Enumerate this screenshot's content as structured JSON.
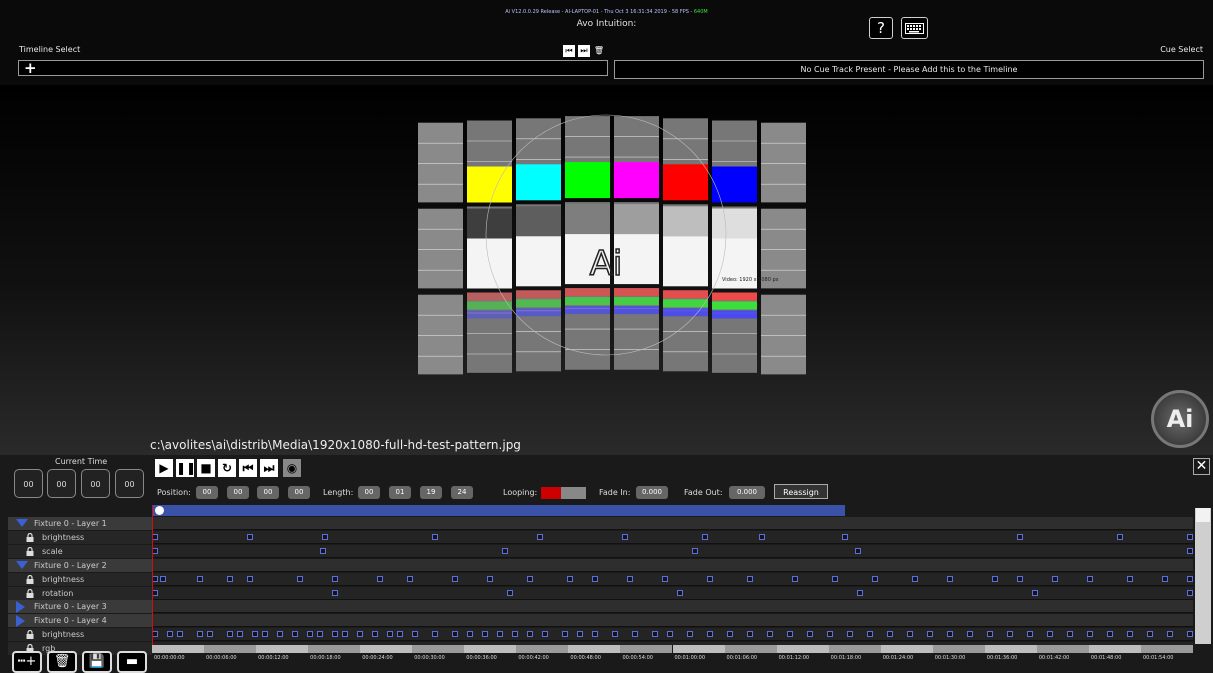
{
  "header": {
    "status_line": "Ai V12.0.0.29 Release - AI-LAPTOP-01 - Thu Oct 3 16:31:34 2019 - 58 FPS -",
    "status_fps": "640M",
    "window_title": "Avo Intuition:",
    "help_label": "?",
    "keyboard_icon": "keyboard-icon"
  },
  "timeline_select": {
    "label": "Timeline Select",
    "add_label": "+"
  },
  "cue_select": {
    "label": "Cue Select",
    "message": "No Cue Track Present - Please Add this to the Timeline"
  },
  "media_path": "c:\\avolites\\ai\\distrib\\Media\\1920x1080-full-hd-test-pattern.jpg",
  "test_pattern": {
    "logo": "Ai",
    "caption": "Video: 1920 x 1080 px"
  },
  "current_time": {
    "label": "Current Time",
    "values": [
      "00",
      "00",
      "00",
      "00"
    ]
  },
  "transport": {
    "position_label": "Position:",
    "position": [
      "00",
      "00",
      "00",
      "00"
    ],
    "length_label": "Length:",
    "length": [
      "00",
      "01",
      "19",
      "24"
    ],
    "looping_label": "Looping:",
    "fade_in_label": "Fade In:",
    "fade_in": "0.000",
    "fade_out_label": "Fade Out:",
    "fade_out": "0.000",
    "reassign_label": "Reassign"
  },
  "tracks": [
    {
      "type": "layer",
      "label": "Fixture 0 - Layer 1"
    },
    {
      "type": "param",
      "label": "brightness"
    },
    {
      "type": "param",
      "label": "scale"
    },
    {
      "type": "layer",
      "label": "Fixture 0 - Layer 2"
    },
    {
      "type": "param",
      "label": "brightness"
    },
    {
      "type": "param",
      "label": "rotation"
    },
    {
      "type": "layer",
      "label": "Fixture 0 - Layer 3"
    },
    {
      "type": "layer",
      "label": "Fixture 0 - Layer 4"
    },
    {
      "type": "param",
      "label": "brightness"
    },
    {
      "type": "param",
      "label": "rgb"
    }
  ],
  "ruler_ticks": [
    "00:00:00:00",
    "00:00:06:00",
    "00:00:12:00",
    "00:00:18:00",
    "00:00:24:00",
    "00:00:30:00",
    "00:00:36:00",
    "00:00:42:00",
    "00:00:48:00",
    "00:00:54:00",
    "00:01:00:00",
    "00:01:06:00",
    "00:01:12:00",
    "00:01:18:00",
    "00:01:24:00",
    "00:01:30:00",
    "00:01:36:00",
    "00:01:42:00",
    "00:01:48:00",
    "00:01:54:00"
  ],
  "colors": {
    "accent": "#3a61d4",
    "playhead": "#d01010",
    "loop_on": "#c00000"
  }
}
